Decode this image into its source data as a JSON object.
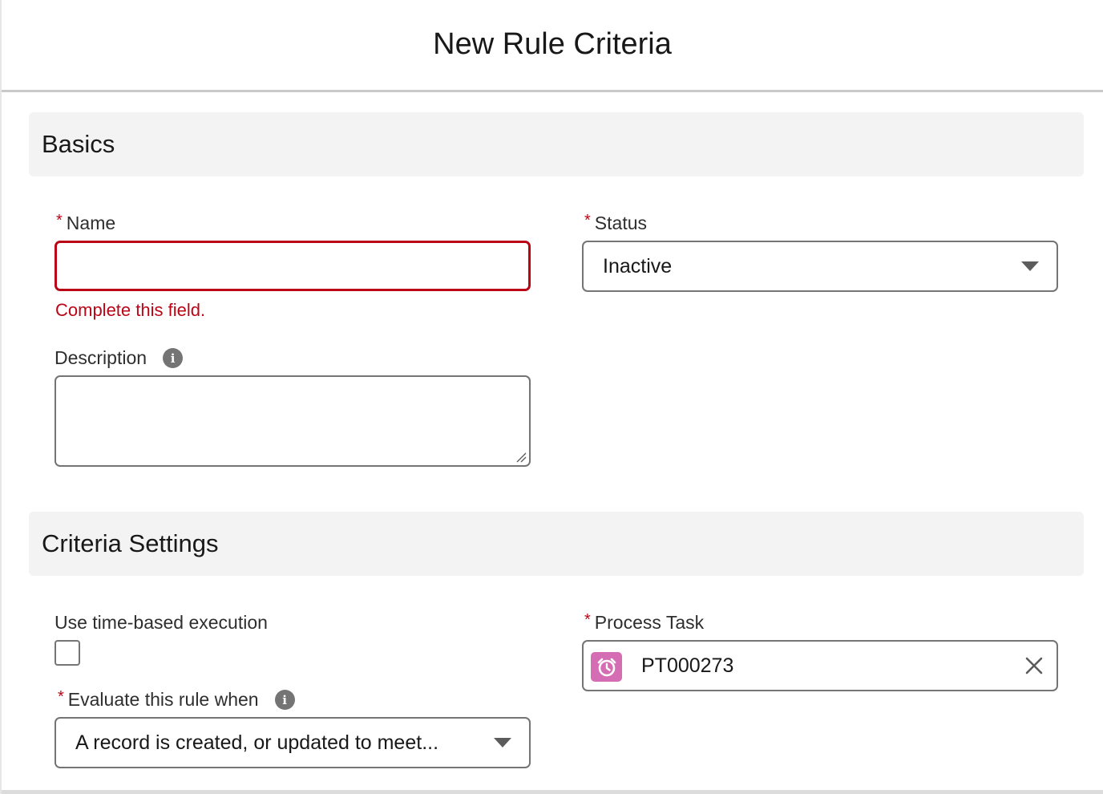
{
  "modal": {
    "title": "New Rule Criteria"
  },
  "basics": {
    "section_title": "Basics",
    "name": {
      "label": "Name",
      "value": "",
      "error": "Complete this field."
    },
    "status": {
      "label": "Status",
      "selected": "Inactive"
    },
    "description": {
      "label": "Description",
      "value": ""
    }
  },
  "criteria": {
    "section_title": "Criteria Settings",
    "time_based": {
      "label": "Use time-based execution",
      "checked": false
    },
    "evaluate": {
      "label": "Evaluate this rule when",
      "selected": "A record is created, or updated to meet..."
    },
    "process_task": {
      "label": "Process Task",
      "value": "PT000273",
      "icon": "alarm-clock-icon"
    }
  },
  "icons": {
    "info": "info-icon",
    "required_mark": "*",
    "clear": "close-icon",
    "dropdown": "chevron-down-icon"
  },
  "colors": {
    "error": "#ba0517",
    "task_icon_bg": "#d56db5",
    "section_bg": "#f3f3f3"
  }
}
